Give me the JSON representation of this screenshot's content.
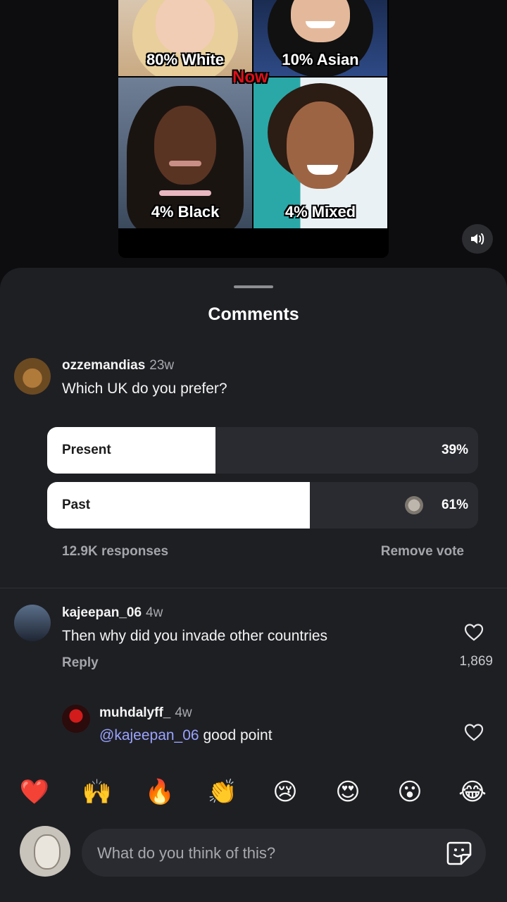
{
  "video": {
    "captions": [
      "80% White",
      "10% Asian",
      "4% Black",
      "4% Mixed"
    ],
    "overlay_label": "Now",
    "sound_icon": "speaker-icon"
  },
  "sheet": {
    "title": "Comments"
  },
  "comment1": {
    "username": "ozzemandias",
    "age": "23w",
    "text": "Which UK do you prefer?",
    "poll": {
      "options": [
        {
          "label": "Present",
          "percent": "39%",
          "fraction": 0.39
        },
        {
          "label": "Past",
          "percent": "61%",
          "fraction": 0.61,
          "voted": true
        }
      ],
      "responses": "12.9K responses",
      "remove_vote": "Remove vote"
    }
  },
  "comment2": {
    "username": "kajeepan_06",
    "age": "4w",
    "text": "Then why did you invade other countries",
    "reply": "Reply",
    "likes": "1,869"
  },
  "reply1": {
    "username": "muhdalyff_",
    "age": "4w",
    "mention": "@kajeepan_06",
    "text": " good point"
  },
  "emojis": [
    "❤️",
    "🙌",
    "🔥",
    "👏",
    "😢",
    "😍",
    "😮",
    "😂"
  ],
  "composer": {
    "placeholder": "What do you think of this?",
    "sticker_icon": "sticker-icon"
  },
  "colors": {
    "sheet_bg": "#1e1f23",
    "accent_mention": "#9aa3ff",
    "poll_fill": "#ffffff"
  }
}
